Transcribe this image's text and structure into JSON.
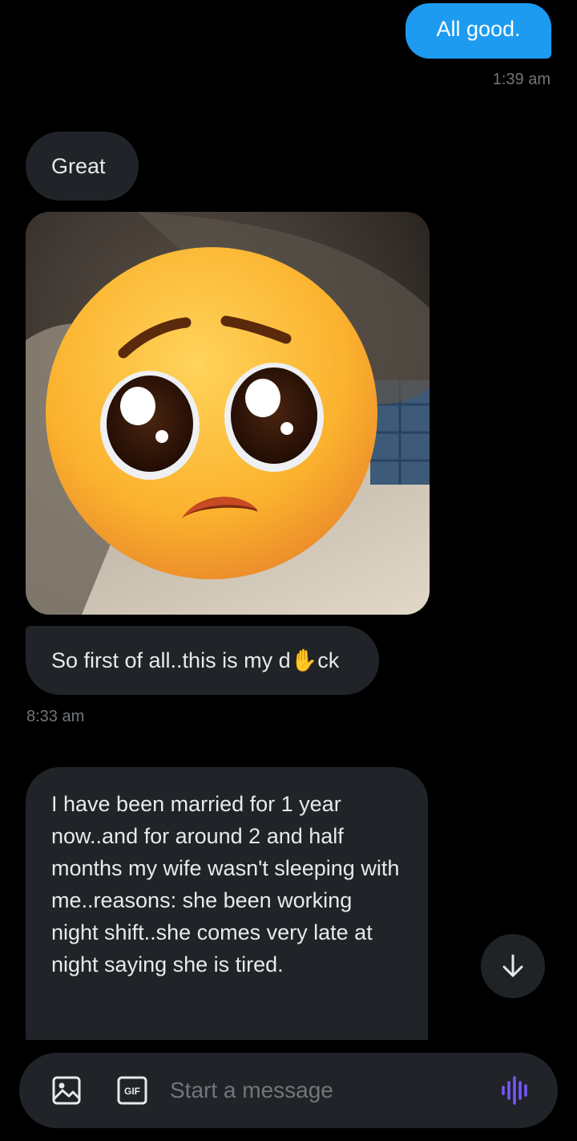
{
  "conversation": {
    "messages": [
      {
        "direction": "outgoing",
        "text": "All good."
      },
      {
        "direction": "incoming",
        "text": "Great"
      },
      {
        "direction": "incoming",
        "type": "image"
      },
      {
        "direction": "incoming",
        "text": "So first of all..this is my d✋ck"
      },
      {
        "direction": "incoming",
        "text": "I have been married for 1 year now..and for around 2 and half months my wife wasn't sleeping with me..reasons: she been working night shift..she comes very late at night saying she is tired."
      }
    ],
    "timestamps": [
      "1:39 am",
      "8:33 am"
    ]
  },
  "composer": {
    "placeholder": "Start a message",
    "gif_label": "GIF"
  },
  "colors": {
    "accent": "#1d9bf0",
    "incoming_bubble": "#202327",
    "voice_icon": "#7856ff"
  }
}
